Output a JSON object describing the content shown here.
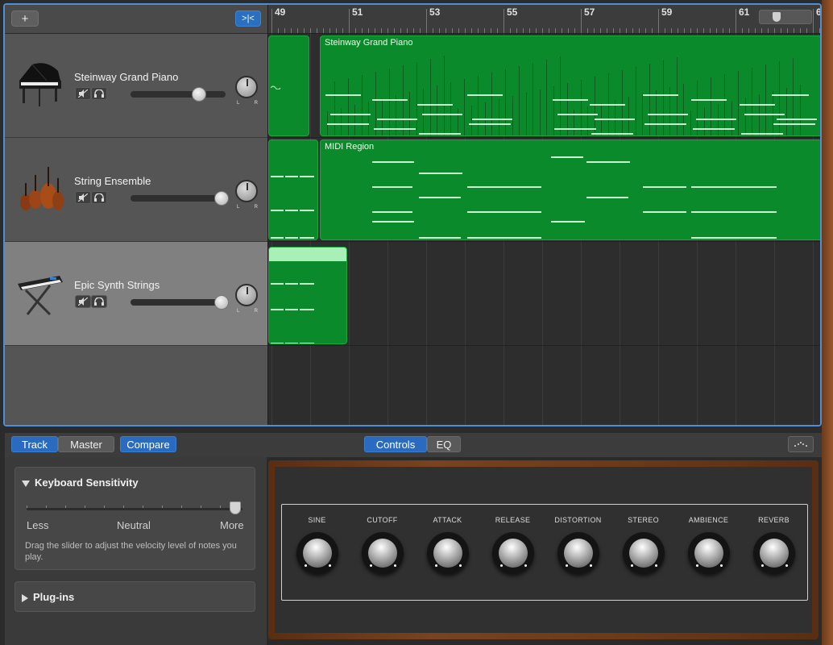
{
  "header": {
    "add_track_label": "+",
    "catch_label": ">|<"
  },
  "ruler": {
    "bars": [
      "49",
      "51",
      "53",
      "55",
      "57",
      "59",
      "61",
      "6"
    ]
  },
  "tracks": [
    {
      "name": "Steinway Grand Piano",
      "instrument_icon": "grand-piano-icon",
      "pan_left": "L",
      "pan_right": "R",
      "volume_level": 0.73
    },
    {
      "name": "String Ensemble",
      "instrument_icon": "string-ensemble-icon",
      "pan_left": "L",
      "pan_right": "R",
      "volume_level": 0.97
    },
    {
      "name": "Epic Synth Strings",
      "instrument_icon": "synth-keyboard-icon",
      "pan_left": "L",
      "pan_right": "R",
      "volume_level": 0.97
    }
  ],
  "regions": {
    "piano_main": "Steinway Grand Piano",
    "strings_main": "MIDI Region"
  },
  "editor": {
    "tabs": {
      "track": "Track",
      "master": "Master",
      "compare": "Compare"
    },
    "views": {
      "controls": "Controls",
      "eq": "EQ"
    },
    "keyboard_sensitivity": {
      "title": "Keyboard Sensitivity",
      "less": "Less",
      "neutral": "Neutral",
      "more": "More",
      "value": 1.0,
      "help": "Drag the slider to adjust the velocity level of notes you play."
    },
    "plugins_title": "Plug-ins"
  },
  "synth": {
    "knobs": [
      "SINE",
      "CUTOFF",
      "ATTACK",
      "RELEASE",
      "DISTORTION",
      "STEREO",
      "AMBIENCE",
      "REVERB"
    ]
  },
  "colors": {
    "accent": "#2b6bbf",
    "region_green": "#0a8a2a",
    "note_color": "#c8f5cf"
  }
}
